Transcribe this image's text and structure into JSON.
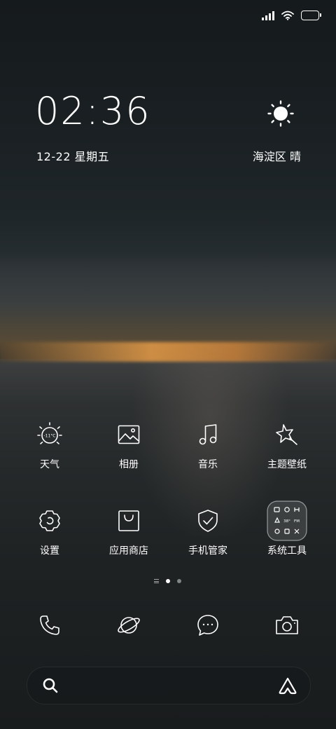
{
  "status_bar": {
    "icons": [
      "signal-icon",
      "wifi-icon",
      "battery-icon"
    ]
  },
  "clock": {
    "time": "02:36",
    "date": "12-22 星期五"
  },
  "weather": {
    "icon": "sun-icon",
    "location_condition": "海淀区 晴"
  },
  "apps_row1": [
    {
      "label": "天气",
      "icon": "weather-icon"
    },
    {
      "label": "相册",
      "icon": "gallery-icon"
    },
    {
      "label": "音乐",
      "icon": "music-icon"
    },
    {
      "label": "主题壁纸",
      "icon": "themes-icon"
    }
  ],
  "apps_row2": [
    {
      "label": "设置",
      "icon": "settings-icon"
    },
    {
      "label": "应用商店",
      "icon": "app-store-icon"
    },
    {
      "label": "手机管家",
      "icon": "security-icon"
    },
    {
      "label": "系统工具",
      "icon": "tools-folder-icon"
    }
  ],
  "page_indicator": {
    "pages": 2,
    "current": 1
  },
  "dock": [
    {
      "icon": "phone-icon"
    },
    {
      "icon": "browser-icon"
    },
    {
      "icon": "messages-icon"
    },
    {
      "icon": "camera-icon"
    }
  ],
  "search": {
    "search_icon": "search-icon",
    "assistant_icon": "assistant-icon"
  },
  "colors": {
    "text": "#ffffff",
    "sunset": "#d68c3c"
  }
}
